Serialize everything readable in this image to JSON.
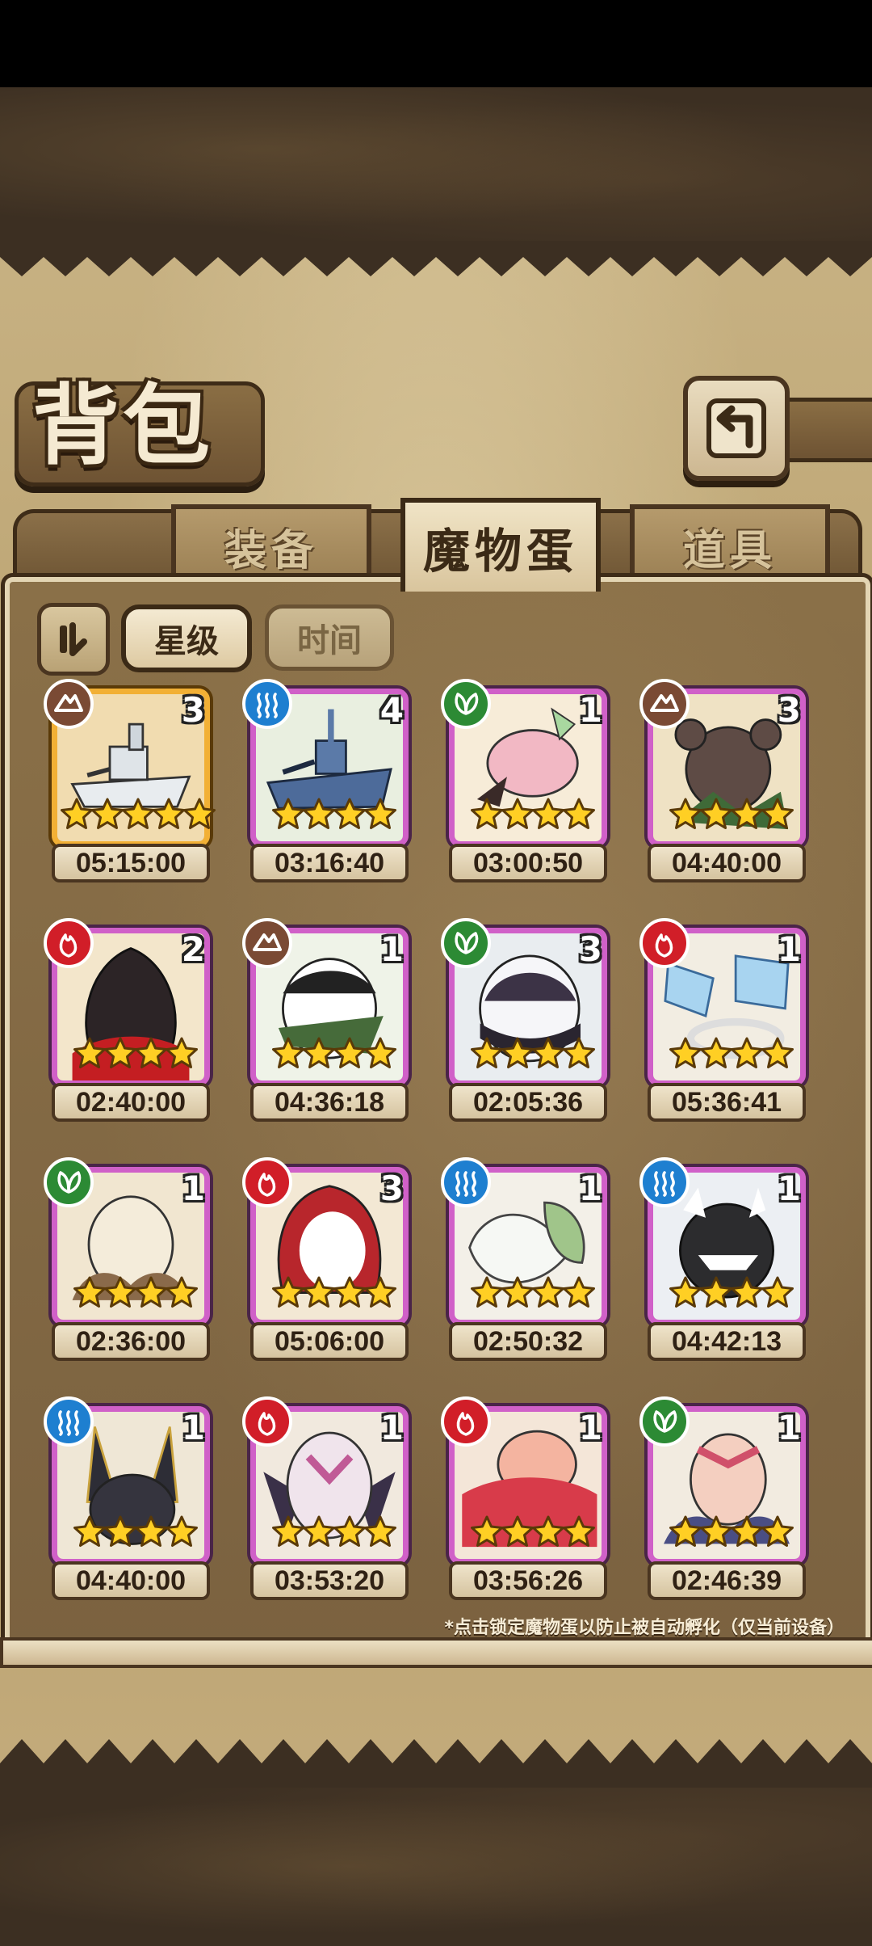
{
  "title": "背包",
  "tabs": [
    {
      "label": "装备",
      "active": false
    },
    {
      "label": "魔物蛋",
      "active": true
    },
    {
      "label": "道具",
      "active": false
    }
  ],
  "filters": {
    "sort_star": "星级",
    "sort_time": "时间"
  },
  "note": "*点击锁定魔物蛋以防止被自动孵化（仅当前设备）",
  "colors": {
    "frame_epic": "#d060c8",
    "frame_legend": "#f2b035",
    "earth": "#7a4a34",
    "water": "#1e7fd0",
    "wood": "#2c8a34",
    "fire": "#d11e28"
  },
  "eggs": [
    {
      "element": "earth",
      "count": "3",
      "stars": 5,
      "time": "05:15:00",
      "rarity": "gold",
      "art": "battleship"
    },
    {
      "element": "water",
      "count": "4",
      "stars": 4,
      "time": "03:16:40",
      "rarity": "purple",
      "art": "warship"
    },
    {
      "element": "wood",
      "count": "1",
      "stars": 4,
      "time": "03:00:50",
      "rarity": "purple",
      "art": "pink"
    },
    {
      "element": "earth",
      "count": "3",
      "stars": 4,
      "time": "04:40:00",
      "rarity": "purple",
      "art": "bear"
    },
    {
      "element": "fire",
      "count": "2",
      "stars": 4,
      "time": "02:40:00",
      "rarity": "purple",
      "art": "obsidian"
    },
    {
      "element": "earth",
      "count": "1",
      "stars": 4,
      "time": "04:36:18",
      "rarity": "purple",
      "art": "panda"
    },
    {
      "element": "wood",
      "count": "3",
      "stars": 4,
      "time": "02:05:36",
      "rarity": "purple",
      "art": "spiked"
    },
    {
      "element": "fire",
      "count": "1",
      "stars": 4,
      "time": "05:36:41",
      "rarity": "purple",
      "art": "flags"
    },
    {
      "element": "wood",
      "count": "1",
      "stars": 4,
      "time": "02:36:00",
      "rarity": "purple",
      "art": "cream"
    },
    {
      "element": "fire",
      "count": "3",
      "stars": 4,
      "time": "05:06:00",
      "rarity": "purple",
      "art": "hood"
    },
    {
      "element": "water",
      "count": "1",
      "stars": 4,
      "time": "02:50:32",
      "rarity": "purple",
      "art": "leaf"
    },
    {
      "element": "water",
      "count": "1",
      "stars": 4,
      "time": "04:42:13",
      "rarity": "purple",
      "art": "shark"
    },
    {
      "element": "water",
      "count": "1",
      "stars": 4,
      "time": "04:40:00",
      "rarity": "purple",
      "art": "anubis"
    },
    {
      "element": "fire",
      "count": "1",
      "stars": 4,
      "time": "03:53:20",
      "rarity": "purple",
      "art": "bat"
    },
    {
      "element": "fire",
      "count": "1",
      "stars": 4,
      "time": "03:56:26",
      "rarity": "purple",
      "art": "kimono"
    },
    {
      "element": "wood",
      "count": "1",
      "stars": 4,
      "time": "02:46:39",
      "rarity": "purple",
      "art": "feather"
    }
  ]
}
